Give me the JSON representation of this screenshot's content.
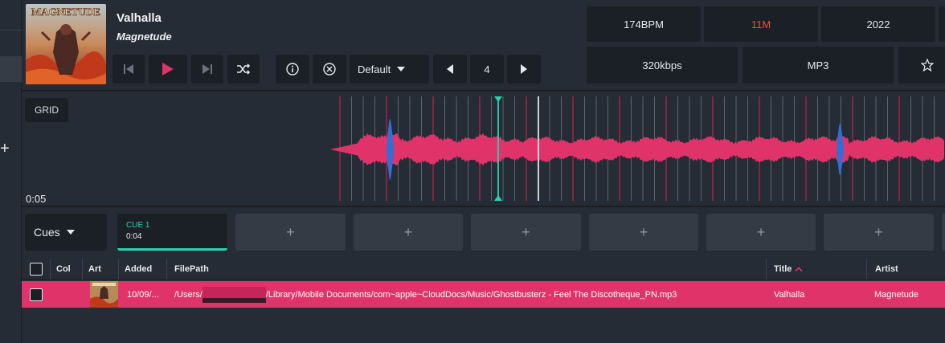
{
  "track": {
    "title": "Valhalla",
    "artist": "Magnetude",
    "art_text": "MAGNETUDE"
  },
  "transport": {
    "preset": "Default",
    "page_number": "4"
  },
  "info_tiles": {
    "bpm": "174BPM",
    "key": "11M",
    "year": "2022",
    "bitrate": "320kbps",
    "format": "MP3"
  },
  "waveform": {
    "grid_label": "GRID",
    "position_time": "0:05"
  },
  "cues": {
    "dropdown_label": "Cues",
    "items": [
      {
        "name": "CUE 1",
        "time": "0:04"
      }
    ],
    "empty_label": "+"
  },
  "table": {
    "headers": {
      "col": "Col",
      "art": "Art",
      "added": "Added",
      "filepath": "FilePath",
      "title": "Title",
      "artist": "Artist"
    },
    "rows": [
      {
        "added": "10/09/...",
        "filepath_prefix": "/Users/",
        "filepath_suffix": "/Library/Mobile Documents/com~apple~CloudDocs/Music/Ghostbusterz - Feel The Discotheque_PN.mp3",
        "title": "Valhalla",
        "artist": "Magnetude"
      }
    ]
  },
  "colors": {
    "accent_pink": "#e0336a",
    "accent_teal": "#27d3b0",
    "key_orange": "#e8543a",
    "wave_blue": "#2f6fd6"
  }
}
